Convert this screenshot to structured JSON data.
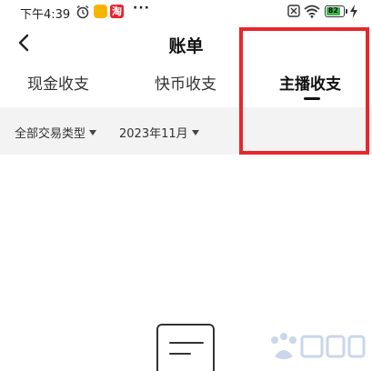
{
  "status_bar": {
    "time": "下午4:39",
    "more": "···",
    "app_badge": "淘",
    "battery_percent": 82,
    "battery_label": "82",
    "icons": [
      "alarm-icon",
      "app-icon",
      "app-icon",
      "sim-icon",
      "wifi-icon",
      "battery-icon",
      "charging-icon"
    ]
  },
  "header": {
    "title": "账单",
    "back_icon": "chevron-left-icon"
  },
  "tabs": [
    {
      "label": "现金收支",
      "active": false
    },
    {
      "label": "快币收支",
      "active": false
    },
    {
      "label": "主播收支",
      "active": true
    }
  ],
  "filters": {
    "transaction_type": "全部交易类型",
    "month": "2023年11月",
    "dropdown_icon": "caret-down-icon"
  },
  "empty_state": {
    "icon": "document-icon"
  },
  "colors": {
    "highlight": "#e8262c",
    "filter_background": "#f3f3f4",
    "active_tab": "#111111",
    "battery": "#3bb54a"
  }
}
